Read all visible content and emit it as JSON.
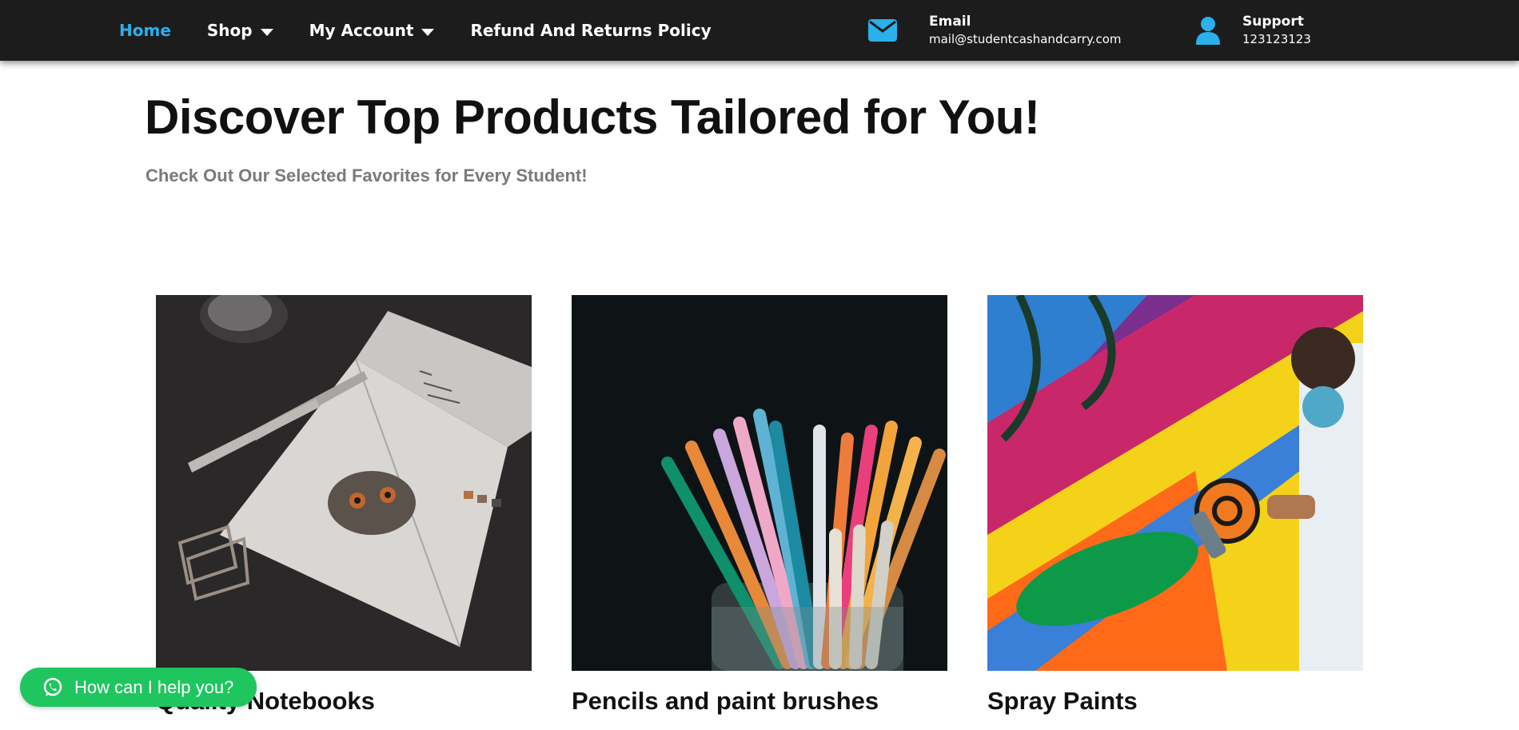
{
  "nav": {
    "items": [
      {
        "label": "Home",
        "active": true,
        "dropdown": false
      },
      {
        "label": "Shop",
        "active": false,
        "dropdown": true
      },
      {
        "label": "My Account",
        "active": false,
        "dropdown": true
      },
      {
        "label": "Refund And Returns Policy",
        "active": false,
        "dropdown": false
      }
    ]
  },
  "contact": {
    "email": {
      "icon": "envelope-icon",
      "label": "Email",
      "value": "mail@studentcashandcarry.com"
    },
    "support": {
      "icon": "user-icon",
      "label": "Support",
      "value": "123123123"
    }
  },
  "hero": {
    "title": "Discover Top Products Tailored for You!",
    "subtitle": "Check Out Our Selected Favorites for Every Student!"
  },
  "products": [
    {
      "title": "Quality Notebooks",
      "image": "notebook-owl-sketch"
    },
    {
      "title": "Pencils and paint brushes",
      "image": "pens-in-jar"
    },
    {
      "title": "Spray Paints",
      "image": "graffiti-spray-painter"
    }
  ],
  "chat": {
    "label": "How can I help you?",
    "icon": "whatsapp-icon"
  },
  "colors": {
    "topbar_bg": "#1c1c1c",
    "accent": "#2ab0ea",
    "chat_green": "#1fc65f",
    "subtitle_gray": "#7a7a7a"
  }
}
